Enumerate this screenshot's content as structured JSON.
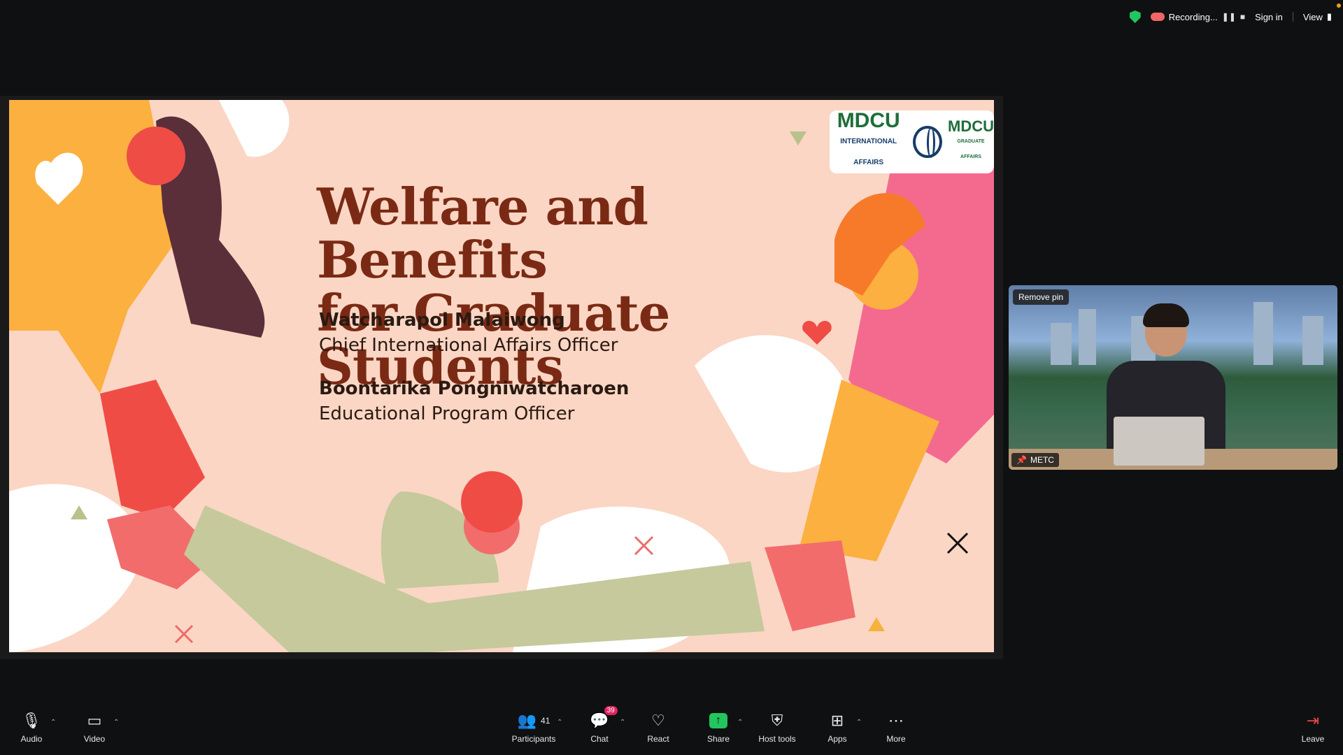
{
  "topbar": {
    "recording": "Recording...",
    "sign_in": "Sign in",
    "view": "View"
  },
  "slide": {
    "title_line1": "Welfare and Benefits",
    "title_line2": "for Graduate Students",
    "presenters": [
      {
        "name": "Watcharapol Malaiwong",
        "role": "Chief International Affairs Officer"
      },
      {
        "name": "Boontarika Pongniwatcharoen",
        "role": "Educational Program Officer"
      }
    ],
    "logo1_text": "MDCU",
    "logo1_sub": "INTERNATIONAL AFFAIRS",
    "logo2_text": "MDCU",
    "logo2_sub": "GRADUATE AFFAIRS"
  },
  "video": {
    "remove_pin": "Remove pin",
    "participant_name": "METC"
  },
  "toolbar": {
    "audio": "Audio",
    "video": "Video",
    "participants": "Participants",
    "participants_count": "41",
    "chat": "Chat",
    "chat_badge": "39",
    "react": "React",
    "share": "Share",
    "host_tools": "Host tools",
    "apps": "Apps",
    "more": "More",
    "leave": "Leave"
  }
}
